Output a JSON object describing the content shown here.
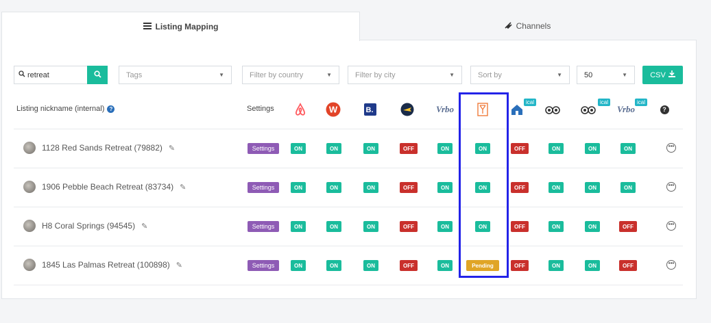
{
  "tabs": {
    "mapping": "Listing Mapping",
    "channels": "Channels"
  },
  "filters": {
    "search_value": "retreat",
    "tags": "Tags",
    "country": "Filter by country",
    "city": "Filter by city",
    "sort": "Sort by",
    "per_page": "50",
    "csv": "CSV"
  },
  "header": {
    "nickname_label": "Listing nickname (internal)",
    "settings_label": "Settings",
    "ical_badge": "ical"
  },
  "channel_icons": [
    "airbnb-icon",
    "w-icon",
    "booking-icon",
    "expedia-icon",
    "vrbo-icon",
    "orange-channel-icon",
    "homeaway-icon",
    "tripadvisor-icon",
    "tripadvisor-icon",
    "vrbo-icon"
  ],
  "settings_button": "Settings",
  "rows": [
    {
      "name": "1128 Red Sands Retreat (79882)",
      "statuses": [
        "ON",
        "ON",
        "ON",
        "OFF",
        "ON",
        "ON",
        "OFF",
        "ON",
        "ON",
        "ON"
      ]
    },
    {
      "name": "1906 Pebble Beach Retreat (83734)",
      "statuses": [
        "ON",
        "ON",
        "ON",
        "OFF",
        "ON",
        "ON",
        "OFF",
        "ON",
        "ON",
        "ON"
      ]
    },
    {
      "name": "H8 Coral Springs (94545)",
      "statuses": [
        "ON",
        "ON",
        "ON",
        "OFF",
        "ON",
        "ON",
        "OFF",
        "ON",
        "ON",
        "OFF"
      ]
    },
    {
      "name": "1845 Las Palmas Retreat (100898)",
      "statuses": [
        "ON",
        "ON",
        "ON",
        "OFF",
        "ON",
        "Pending",
        "OFF",
        "ON",
        "ON",
        "OFF"
      ]
    }
  ],
  "colors": {
    "accent": "#1abc9c",
    "off": "#c9302c",
    "pending": "#e0a526",
    "settings": "#8e5bb5",
    "highlight": "#2323e8"
  }
}
